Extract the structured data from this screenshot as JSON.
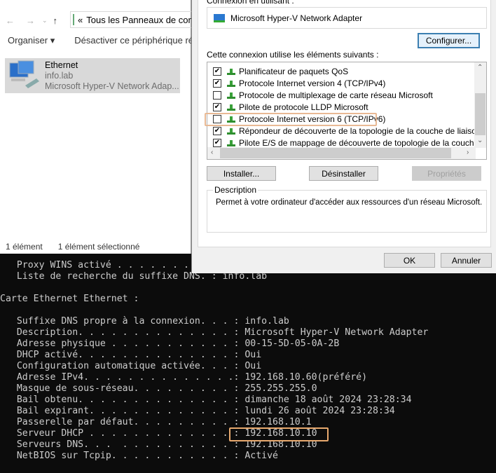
{
  "explorer": {
    "address": "Tous les Panneaux de configuration",
    "address_prefix": "«",
    "organize": "Organiser ▾",
    "disable": "Désactiver ce périphérique réseau",
    "item": {
      "name": "Ethernet",
      "domain": "info.lab",
      "adapter": "Microsoft Hyper-V Network Adap..."
    },
    "status": {
      "count": "1 élément",
      "selected": "1 élément sélectionné"
    }
  },
  "dialog": {
    "connect_using_label": "Connexion en utilisant :",
    "adapter": "Microsoft Hyper-V Network Adapter",
    "configure": "Configurer...",
    "items_label": "Cette connexion utilise les éléments suivants :",
    "items": [
      {
        "label": "Planificateur de paquets QoS",
        "checked": true
      },
      {
        "label": "Protocole Internet version 4 (TCP/IPv4)",
        "checked": true
      },
      {
        "label": "Protocole de multiplexage de carte réseau Microsoft",
        "checked": false
      },
      {
        "label": "Pilote de protocole LLDP Microsoft",
        "checked": true
      },
      {
        "label": "Protocole Internet version 6 (TCP/IPv6)",
        "checked": false
      },
      {
        "label": "Répondeur de découverte de la topologie de la couche de liaison",
        "checked": true
      },
      {
        "label": "Pilote E/S de mappage de découverte de topologie de la couche de liaison",
        "checked": true
      }
    ],
    "install": "Installer...",
    "uninstall": "Désinstaller",
    "properties": "Propriétés",
    "description_label": "Description",
    "description": "Permet à votre ordinateur d'accéder aux ressources d'un réseau Microsoft.",
    "ok": "OK",
    "cancel": "Annuler"
  },
  "terminal": {
    "lines": [
      "   Proxy WINS activé . . . . . . . . : Non",
      "   Liste de recherche du suffixe DNS. : info.lab",
      "",
      "Carte Ethernet Ethernet :",
      "",
      "   Suffixe DNS propre à la connexion. . . : info.lab",
      "   Description. . . . . . . . . . . . . . : Microsoft Hyper-V Network Adapter",
      "   Adresse physique . . . . . . . . . . . : 00-15-5D-05-0A-2B",
      "   DHCP activé. . . . . . . . . . . . . . : Oui",
      "   Configuration automatique activée. . . : Oui",
      "   Adresse IPv4. . . . . . . . . . . . . .: 192.168.10.60(préféré)",
      "   Masque de sous-réseau. . . . . . . . . : 255.255.255.0",
      "   Bail obtenu. . . . . . . . . . . . . . : dimanche 18 août 2024 23:28:34",
      "   Bail expirant. . . . . . . . . . . . . : lundi 26 août 2024 23:28:34",
      "   Passerelle par défaut. . . . . . . . . : 192.168.10.1",
      "   Serveur DHCP . . . . . . . . . . . . . : 192.168.10.10",
      "   Serveurs DNS. . .  . . . . . . . . . . : 192.168.10.10",
      "   NetBIOS sur Tcpip. . . . . . . . . . . : Activé"
    ]
  }
}
